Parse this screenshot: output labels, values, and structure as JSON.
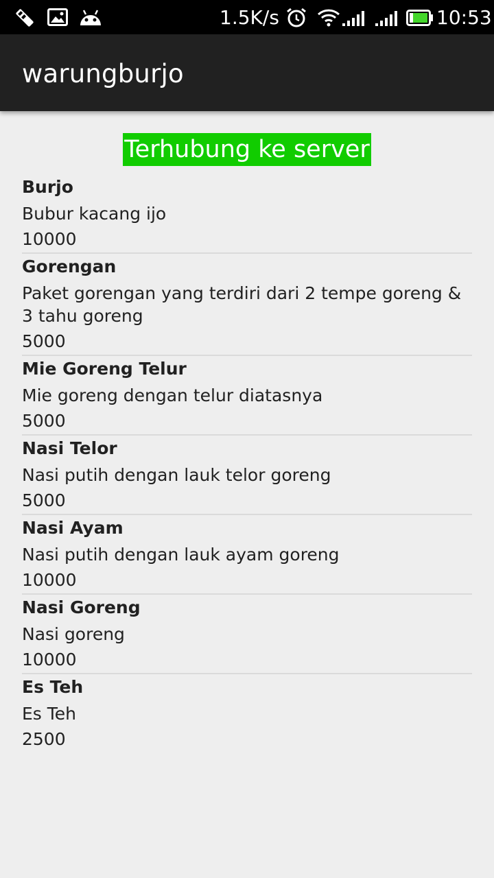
{
  "status_bar": {
    "network_speed": "1.5K/s",
    "time": "10:53",
    "icons": [
      "usb-debug-icon",
      "image-icon",
      "android-icon",
      "alarm-icon",
      "wifi-icon",
      "signal-icon",
      "signal-icon",
      "battery-icon"
    ]
  },
  "app_bar": {
    "title": "warungburjo"
  },
  "connection_banner": {
    "text": "Terhubung ke server",
    "color": "#11cc00"
  },
  "menu": [
    {
      "name": "Burjo",
      "description": "Bubur kacang ijo",
      "price": "10000"
    },
    {
      "name": "Gorengan",
      "description": "Paket gorengan yang terdiri dari 2 tempe goreng & 3 tahu goreng",
      "price": "5000"
    },
    {
      "name": "Mie Goreng Telur",
      "description": "Mie goreng dengan telur diatasnya",
      "price": "5000"
    },
    {
      "name": "Nasi Telor",
      "description": "Nasi putih dengan lauk telor goreng",
      "price": "5000"
    },
    {
      "name": "Nasi Ayam",
      "description": "Nasi putih dengan lauk ayam goreng",
      "price": "10000"
    },
    {
      "name": "Nasi Goreng",
      "description": "Nasi goreng",
      "price": "10000"
    },
    {
      "name": "Es Teh",
      "description": "Es Teh",
      "price": "2500"
    }
  ]
}
